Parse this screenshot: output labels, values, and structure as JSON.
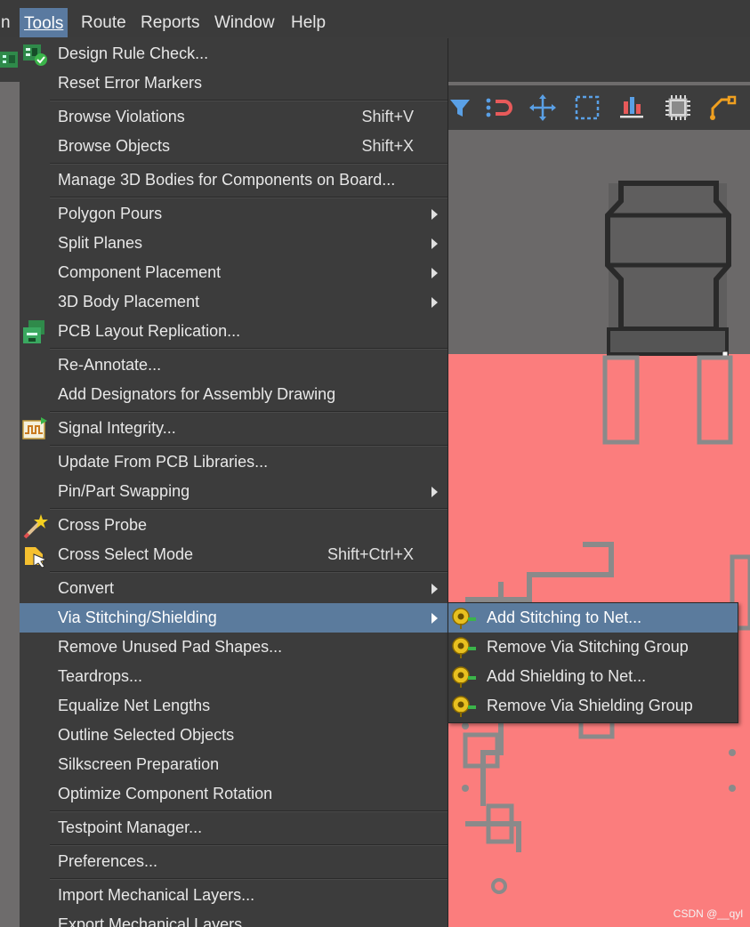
{
  "menubar": {
    "items": [
      {
        "label": "n"
      },
      {
        "label": "Tools"
      },
      {
        "label": "Route"
      },
      {
        "label": "Reports"
      },
      {
        "label": "Window"
      },
      {
        "label": "Help"
      }
    ]
  },
  "tools_menu": {
    "items": [
      {
        "label": "Design Rule Check...",
        "icon": "drc-icon"
      },
      {
        "label": "Reset Error Markers"
      },
      {
        "label": "Browse Violations",
        "shortcut": "Shift+V"
      },
      {
        "label": "Browse Objects",
        "shortcut": "Shift+X"
      },
      {
        "label": "Manage 3D Bodies for Components on Board..."
      },
      {
        "label": "Polygon Pours",
        "submenu": true
      },
      {
        "label": "Split Planes",
        "submenu": true
      },
      {
        "label": "Component Placement",
        "submenu": true
      },
      {
        "label": "3D Body Placement",
        "submenu": true
      },
      {
        "label": "PCB Layout Replication...",
        "icon": "layout-replication-icon"
      },
      {
        "label": "Re-Annotate..."
      },
      {
        "label": "Add Designators for Assembly Drawing"
      },
      {
        "label": "Signal Integrity...",
        "icon": "signal-integrity-icon"
      },
      {
        "label": "Update From PCB Libraries..."
      },
      {
        "label": "Pin/Part Swapping",
        "submenu": true
      },
      {
        "label": "Cross Probe",
        "icon": "cross-probe-icon"
      },
      {
        "label": "Cross Select Mode",
        "shortcut": "Shift+Ctrl+X",
        "icon": "cross-select-icon"
      },
      {
        "label": "Convert",
        "submenu": true
      },
      {
        "label": "Via Stitching/Shielding",
        "submenu": true,
        "highlighted": true
      },
      {
        "label": "Remove Unused Pad Shapes..."
      },
      {
        "label": "Teardrops..."
      },
      {
        "label": "Equalize Net Lengths"
      },
      {
        "label": "Outline Selected Objects"
      },
      {
        "label": "Silkscreen Preparation"
      },
      {
        "label": "Optimize Component Rotation"
      },
      {
        "label": "Testpoint Manager..."
      },
      {
        "label": "Preferences..."
      },
      {
        "label": "Import Mechanical Layers..."
      },
      {
        "label": "Export Mechanical Layers..."
      }
    ]
  },
  "submenu": {
    "items": [
      {
        "label": "Add Stitching to Net...",
        "highlighted": true,
        "icon": "via-icon"
      },
      {
        "label": "Remove Via Stitching Group",
        "icon": "via-icon"
      },
      {
        "label": "Add Shielding to Net...",
        "icon": "via-icon"
      },
      {
        "label": "Remove Via Shielding Group",
        "icon": "via-icon"
      }
    ]
  },
  "watermark": "CSDN @__qyl",
  "colors": {
    "menu_bg": "#3c3c3c",
    "highlight": "#5b7b9d",
    "pcb_red": "#fb7d7d",
    "toolbar_accent": "#5aa0e6"
  }
}
